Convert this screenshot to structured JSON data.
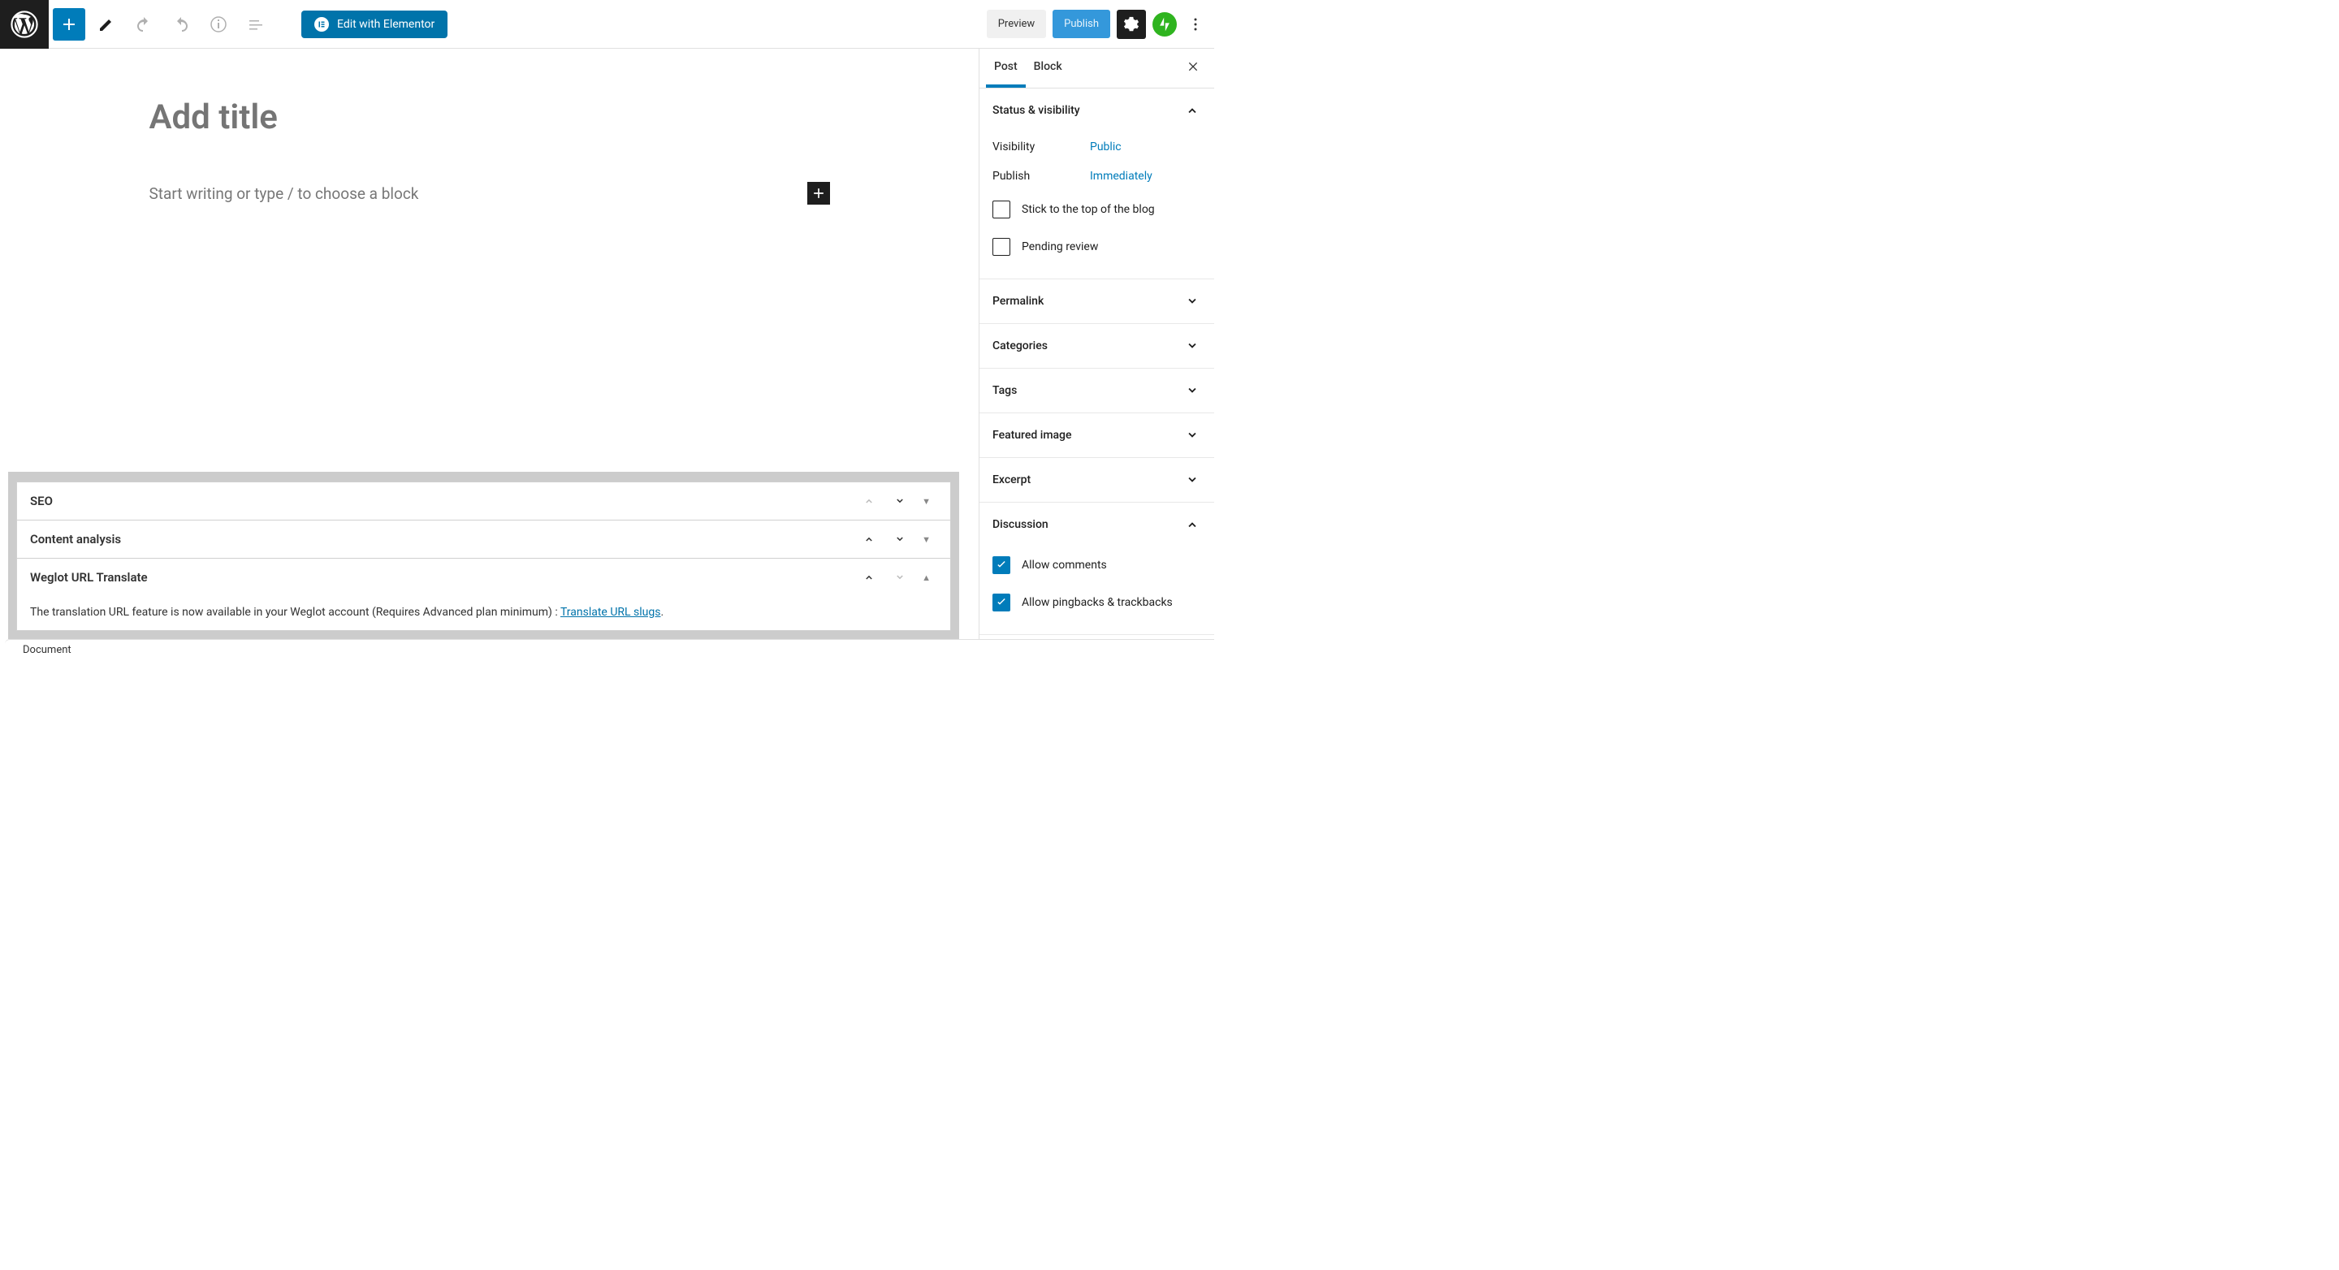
{
  "toolbar": {
    "elementor_label": "Edit with Elementor",
    "preview_label": "Preview",
    "publish_label": "Publish"
  },
  "editor": {
    "title_placeholder": "Add title",
    "block_placeholder": "Start writing or type / to choose a block"
  },
  "metaboxes": {
    "seo": {
      "title": "SEO"
    },
    "content_analysis": {
      "title": "Content analysis"
    },
    "weglot": {
      "title": "Weglot URL Translate",
      "text_before": "The translation URL feature is now available in your Weglot account (Requires Advanced plan minimum) : ",
      "link_text": "Translate URL slugs",
      "text_after": "."
    }
  },
  "sidebar": {
    "tabs": {
      "post": "Post",
      "block": "Block"
    },
    "panels": {
      "status": {
        "title": "Status & visibility",
        "rows": {
          "visibility": {
            "label": "Visibility",
            "value": "Public"
          },
          "publish": {
            "label": "Publish",
            "value": "Immediately"
          }
        },
        "checkboxes": {
          "sticky": "Stick to the top of the blog",
          "pending": "Pending review"
        }
      },
      "permalink": {
        "title": "Permalink"
      },
      "categories": {
        "title": "Categories"
      },
      "tags": {
        "title": "Tags"
      },
      "featured": {
        "title": "Featured image"
      },
      "excerpt": {
        "title": "Excerpt"
      },
      "discussion": {
        "title": "Discussion",
        "checkboxes": {
          "comments": "Allow comments",
          "pingbacks": "Allow pingbacks & trackbacks"
        }
      }
    }
  },
  "footer": {
    "document": "Document"
  }
}
